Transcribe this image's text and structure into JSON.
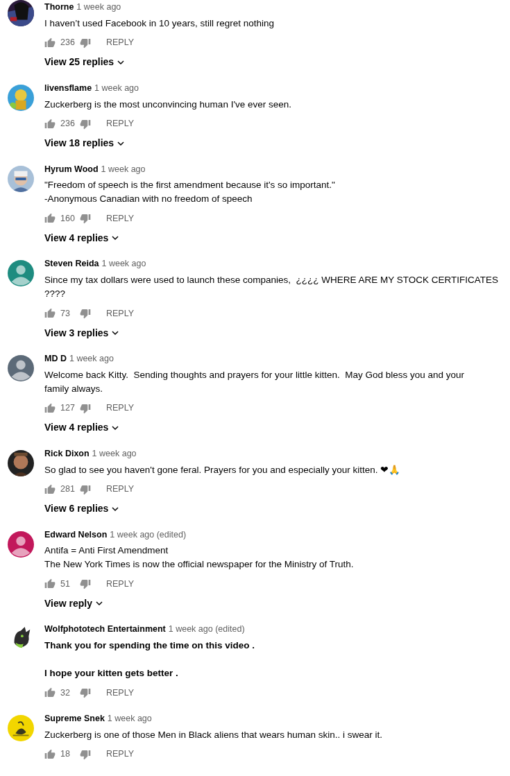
{
  "comments": [
    {
      "author": "Thorne",
      "time": "1 week ago",
      "text": "I haven’t used Facebook in 10 years, still regret nothing",
      "bold": false,
      "likes": "236",
      "reply": "REPLY",
      "view_replies": "View 25 replies"
    },
    {
      "author": "livensflame",
      "time": "1 week ago",
      "text": "Zuckerberg is the most unconvincing human I've ever seen.",
      "bold": false,
      "likes": "236",
      "reply": "REPLY",
      "view_replies": "View 18 replies"
    },
    {
      "author": "Hyrum Wood",
      "time": "1 week ago",
      "text": "\"Freedom of speech is the first amendment because it's so important.\"\n-Anonymous Canadian with no freedom of speech",
      "bold": false,
      "likes": "160",
      "reply": "REPLY",
      "view_replies": "View 4 replies"
    },
    {
      "author": "Steven Reida",
      "time": "1 week ago",
      "avatar": {
        "kind": "default",
        "color": "#1e8c80"
      },
      "text": "Since my tax dollars were used to launch these companies,  ¿¿¿¿ WHERE ARE MY STOCK CERTIFICATES\n????",
      "bold": false,
      "likes": "73",
      "reply": "REPLY",
      "view_replies": "View 3 replies"
    },
    {
      "author": "MD D",
      "time": "1 week ago",
      "avatar": {
        "kind": "default",
        "color": "#5c6a78"
      },
      "text": "Welcome back Kitty.  Sending thoughts and prayers for your little kitten.  May God bless you and your\nfamily always.",
      "bold": false,
      "likes": "127",
      "reply": "REPLY",
      "view_replies": "View 4 replies"
    },
    {
      "author": "Rick Dixon",
      "time": "1 week ago",
      "text": "So glad to see you haven't gone feral. Prayers for you and especially your kitten. ❤🙏",
      "bold": false,
      "likes": "281",
      "reply": "REPLY",
      "view_replies": "View 6 replies"
    },
    {
      "author": "Edward Nelson",
      "time": "1 week ago (edited)",
      "avatar": {
        "kind": "default",
        "color": "#c2185b"
      },
      "text": "Antifa = Anti First Amendment\nThe New York Times is now the official newspaper for the Ministry of Truth.",
      "bold": false,
      "likes": "51",
      "reply": "REPLY",
      "view_replies": "View reply"
    },
    {
      "author": "Wolfphototech Entertainment",
      "time": "1 week ago (edited)",
      "text": "Thank you for spending the time on this video .\n\nI hope your kitten gets better .",
      "bold": true,
      "likes": "32",
      "reply": "REPLY"
    },
    {
      "author": "Supreme Snek",
      "time": "1 week ago",
      "text": "Zuckerberg is one of those Men in Black aliens that wears human skin.. i swear it.",
      "bold": false,
      "likes": "18",
      "reply": "REPLY"
    }
  ]
}
